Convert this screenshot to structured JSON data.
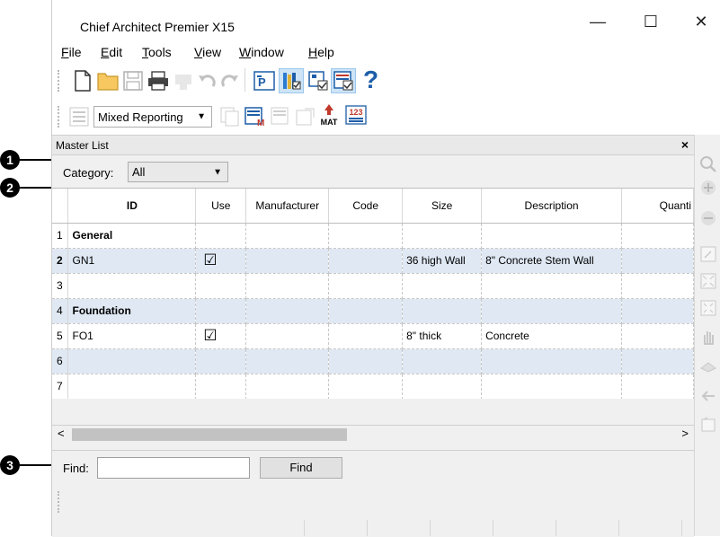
{
  "window": {
    "title": "Chief Architect Premier X15"
  },
  "window_controls": {
    "minimize": "—",
    "maximize": "☐",
    "close": "✕"
  },
  "menu": [
    {
      "accel": "F",
      "rest": "ile"
    },
    {
      "accel": "E",
      "rest": "dit"
    },
    {
      "accel": "T",
      "rest": "ools"
    },
    {
      "accel": "V",
      "rest": "iew"
    },
    {
      "accel": "W",
      "rest": "indow"
    },
    {
      "accel": "H",
      "rest": "elp"
    }
  ],
  "toolbar2": {
    "reporting_mode": "Mixed Reporting",
    "mat_label": "MAT",
    "count_label": "123"
  },
  "panel": {
    "title": "Master List",
    "close": "×"
  },
  "category": {
    "label": "Category:",
    "value": "All"
  },
  "columns": [
    "ID",
    "Use",
    "Manufacturer",
    "Code",
    "Size",
    "Description",
    "Quanti"
  ],
  "rows": [
    {
      "num": "1",
      "id": "General",
      "use": "",
      "manufacturer": "",
      "code": "",
      "size": "",
      "description": "",
      "quantity": "",
      "header": true
    },
    {
      "num": "2",
      "id": "GN1",
      "use": "☑",
      "manufacturer": "",
      "code": "",
      "size": "36 high Wall",
      "description": "8\" Concrete Stem Wall",
      "quantity": "",
      "header": false
    },
    {
      "num": "3",
      "id": "",
      "use": "",
      "manufacturer": "",
      "code": "",
      "size": "",
      "description": "",
      "quantity": "",
      "header": false
    },
    {
      "num": "4",
      "id": "Foundation",
      "use": "",
      "manufacturer": "",
      "code": "",
      "size": "",
      "description": "",
      "quantity": "",
      "header": true
    },
    {
      "num": "5",
      "id": "FO1",
      "use": "☑",
      "manufacturer": "",
      "code": "",
      "size": "8\" thick",
      "description": "Concrete",
      "quantity": "",
      "header": false
    },
    {
      "num": "6",
      "id": "",
      "use": "",
      "manufacturer": "",
      "code": "",
      "size": "",
      "description": "",
      "quantity": "",
      "header": false
    },
    {
      "num": "7",
      "id": "",
      "use": "",
      "manufacturer": "",
      "code": "",
      "size": "",
      "description": "",
      "quantity": "",
      "header": false
    }
  ],
  "find": {
    "label": "Find:",
    "value": "",
    "button": "Find"
  },
  "callouts": [
    "1",
    "2",
    "3"
  ],
  "colors": {
    "selected_row": "#dfe8f3",
    "toolbar_pressed": "#cde4f7",
    "panel_bg": "#f0f0f0"
  }
}
